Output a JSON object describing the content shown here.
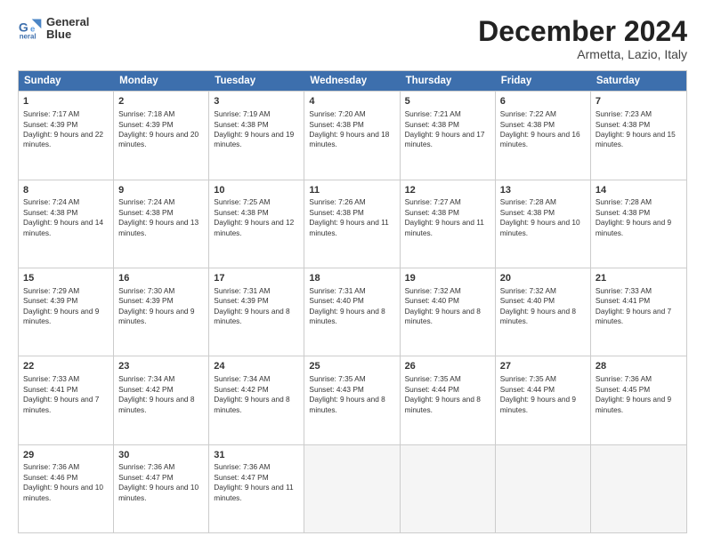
{
  "logo": {
    "line1": "General",
    "line2": "Blue"
  },
  "title": "December 2024",
  "subtitle": "Armetta, Lazio, Italy",
  "weekdays": [
    "Sunday",
    "Monday",
    "Tuesday",
    "Wednesday",
    "Thursday",
    "Friday",
    "Saturday"
  ],
  "rows": [
    [
      {
        "day": "1",
        "sunrise": "Sunrise: 7:17 AM",
        "sunset": "Sunset: 4:39 PM",
        "daylight": "Daylight: 9 hours and 22 minutes."
      },
      {
        "day": "2",
        "sunrise": "Sunrise: 7:18 AM",
        "sunset": "Sunset: 4:39 PM",
        "daylight": "Daylight: 9 hours and 20 minutes."
      },
      {
        "day": "3",
        "sunrise": "Sunrise: 7:19 AM",
        "sunset": "Sunset: 4:38 PM",
        "daylight": "Daylight: 9 hours and 19 minutes."
      },
      {
        "day": "4",
        "sunrise": "Sunrise: 7:20 AM",
        "sunset": "Sunset: 4:38 PM",
        "daylight": "Daylight: 9 hours and 18 minutes."
      },
      {
        "day": "5",
        "sunrise": "Sunrise: 7:21 AM",
        "sunset": "Sunset: 4:38 PM",
        "daylight": "Daylight: 9 hours and 17 minutes."
      },
      {
        "day": "6",
        "sunrise": "Sunrise: 7:22 AM",
        "sunset": "Sunset: 4:38 PM",
        "daylight": "Daylight: 9 hours and 16 minutes."
      },
      {
        "day": "7",
        "sunrise": "Sunrise: 7:23 AM",
        "sunset": "Sunset: 4:38 PM",
        "daylight": "Daylight: 9 hours and 15 minutes."
      }
    ],
    [
      {
        "day": "8",
        "sunrise": "Sunrise: 7:24 AM",
        "sunset": "Sunset: 4:38 PM",
        "daylight": "Daylight: 9 hours and 14 minutes."
      },
      {
        "day": "9",
        "sunrise": "Sunrise: 7:24 AM",
        "sunset": "Sunset: 4:38 PM",
        "daylight": "Daylight: 9 hours and 13 minutes."
      },
      {
        "day": "10",
        "sunrise": "Sunrise: 7:25 AM",
        "sunset": "Sunset: 4:38 PM",
        "daylight": "Daylight: 9 hours and 12 minutes."
      },
      {
        "day": "11",
        "sunrise": "Sunrise: 7:26 AM",
        "sunset": "Sunset: 4:38 PM",
        "daylight": "Daylight: 9 hours and 11 minutes."
      },
      {
        "day": "12",
        "sunrise": "Sunrise: 7:27 AM",
        "sunset": "Sunset: 4:38 PM",
        "daylight": "Daylight: 9 hours and 11 minutes."
      },
      {
        "day": "13",
        "sunrise": "Sunrise: 7:28 AM",
        "sunset": "Sunset: 4:38 PM",
        "daylight": "Daylight: 9 hours and 10 minutes."
      },
      {
        "day": "14",
        "sunrise": "Sunrise: 7:28 AM",
        "sunset": "Sunset: 4:38 PM",
        "daylight": "Daylight: 9 hours and 9 minutes."
      }
    ],
    [
      {
        "day": "15",
        "sunrise": "Sunrise: 7:29 AM",
        "sunset": "Sunset: 4:39 PM",
        "daylight": "Daylight: 9 hours and 9 minutes."
      },
      {
        "day": "16",
        "sunrise": "Sunrise: 7:30 AM",
        "sunset": "Sunset: 4:39 PM",
        "daylight": "Daylight: 9 hours and 9 minutes."
      },
      {
        "day": "17",
        "sunrise": "Sunrise: 7:31 AM",
        "sunset": "Sunset: 4:39 PM",
        "daylight": "Daylight: 9 hours and 8 minutes."
      },
      {
        "day": "18",
        "sunrise": "Sunrise: 7:31 AM",
        "sunset": "Sunset: 4:40 PM",
        "daylight": "Daylight: 9 hours and 8 minutes."
      },
      {
        "day": "19",
        "sunrise": "Sunrise: 7:32 AM",
        "sunset": "Sunset: 4:40 PM",
        "daylight": "Daylight: 9 hours and 8 minutes."
      },
      {
        "day": "20",
        "sunrise": "Sunrise: 7:32 AM",
        "sunset": "Sunset: 4:40 PM",
        "daylight": "Daylight: 9 hours and 8 minutes."
      },
      {
        "day": "21",
        "sunrise": "Sunrise: 7:33 AM",
        "sunset": "Sunset: 4:41 PM",
        "daylight": "Daylight: 9 hours and 7 minutes."
      }
    ],
    [
      {
        "day": "22",
        "sunrise": "Sunrise: 7:33 AM",
        "sunset": "Sunset: 4:41 PM",
        "daylight": "Daylight: 9 hours and 7 minutes."
      },
      {
        "day": "23",
        "sunrise": "Sunrise: 7:34 AM",
        "sunset": "Sunset: 4:42 PM",
        "daylight": "Daylight: 9 hours and 8 minutes."
      },
      {
        "day": "24",
        "sunrise": "Sunrise: 7:34 AM",
        "sunset": "Sunset: 4:42 PM",
        "daylight": "Daylight: 9 hours and 8 minutes."
      },
      {
        "day": "25",
        "sunrise": "Sunrise: 7:35 AM",
        "sunset": "Sunset: 4:43 PM",
        "daylight": "Daylight: 9 hours and 8 minutes."
      },
      {
        "day": "26",
        "sunrise": "Sunrise: 7:35 AM",
        "sunset": "Sunset: 4:44 PM",
        "daylight": "Daylight: 9 hours and 8 minutes."
      },
      {
        "day": "27",
        "sunrise": "Sunrise: 7:35 AM",
        "sunset": "Sunset: 4:44 PM",
        "daylight": "Daylight: 9 hours and 9 minutes."
      },
      {
        "day": "28",
        "sunrise": "Sunrise: 7:36 AM",
        "sunset": "Sunset: 4:45 PM",
        "daylight": "Daylight: 9 hours and 9 minutes."
      }
    ],
    [
      {
        "day": "29",
        "sunrise": "Sunrise: 7:36 AM",
        "sunset": "Sunset: 4:46 PM",
        "daylight": "Daylight: 9 hours and 10 minutes."
      },
      {
        "day": "30",
        "sunrise": "Sunrise: 7:36 AM",
        "sunset": "Sunset: 4:47 PM",
        "daylight": "Daylight: 9 hours and 10 minutes."
      },
      {
        "day": "31",
        "sunrise": "Sunrise: 7:36 AM",
        "sunset": "Sunset: 4:47 PM",
        "daylight": "Daylight: 9 hours and 11 minutes."
      },
      {
        "day": "",
        "sunrise": "",
        "sunset": "",
        "daylight": ""
      },
      {
        "day": "",
        "sunrise": "",
        "sunset": "",
        "daylight": ""
      },
      {
        "day": "",
        "sunrise": "",
        "sunset": "",
        "daylight": ""
      },
      {
        "day": "",
        "sunrise": "",
        "sunset": "",
        "daylight": ""
      }
    ]
  ]
}
